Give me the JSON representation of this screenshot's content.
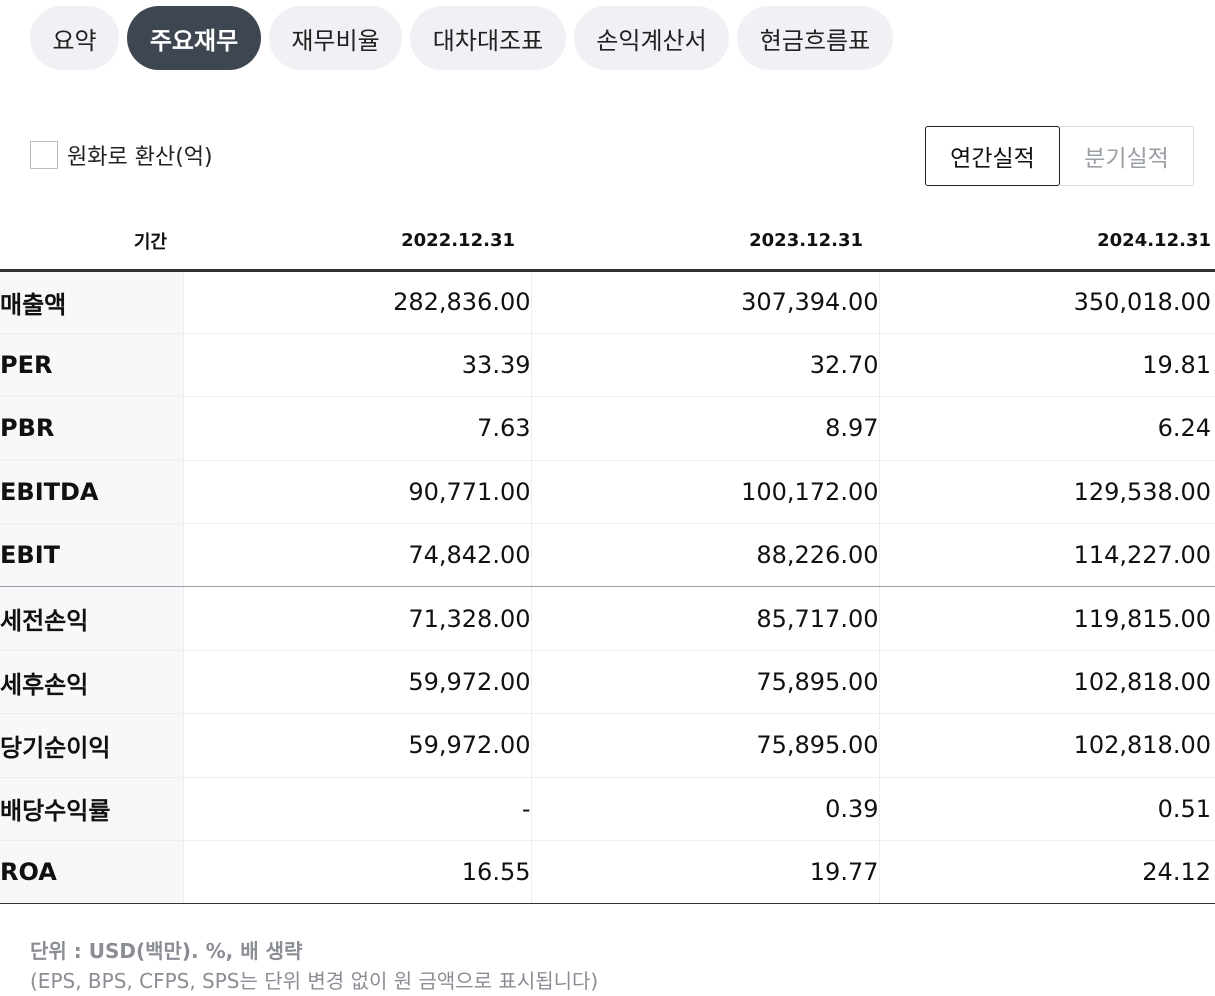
{
  "tabs": [
    {
      "label": "요약"
    },
    {
      "label": "주요재무"
    },
    {
      "label": "재무비율"
    },
    {
      "label": "대차대조표"
    },
    {
      "label": "손익계산서"
    },
    {
      "label": "현금흐름표"
    }
  ],
  "active_tab": "주요재무",
  "convert_checkbox": {
    "label": "원화로 환산(억)",
    "checked": false
  },
  "period_toggle": {
    "annual": "연간실적",
    "quarterly": "분기실적",
    "selected": "연간실적"
  },
  "table": {
    "header": {
      "label": "기간",
      "years": [
        "2022.12.31",
        "2023.12.31",
        "2024.12.31"
      ]
    },
    "rows": [
      {
        "label": "매출액",
        "values": [
          "282,836.00",
          "307,394.00",
          "350,018.00"
        ]
      },
      {
        "label": "PER",
        "values": [
          "33.39",
          "32.70",
          "19.81"
        ]
      },
      {
        "label": "PBR",
        "values": [
          "7.63",
          "8.97",
          "6.24"
        ]
      },
      {
        "label": "EBITDA",
        "values": [
          "90,771.00",
          "100,172.00",
          "129,538.00"
        ]
      },
      {
        "label": "EBIT",
        "values": [
          "74,842.00",
          "88,226.00",
          "114,227.00"
        ]
      },
      {
        "label": "세전손익",
        "values": [
          "71,328.00",
          "85,717.00",
          "119,815.00"
        ]
      },
      {
        "label": "세후손익",
        "values": [
          "59,972.00",
          "75,895.00",
          "102,818.00"
        ]
      },
      {
        "label": "당기순이익",
        "values": [
          "59,972.00",
          "75,895.00",
          "102,818.00"
        ]
      },
      {
        "label": "배당수익률",
        "values": [
          "-",
          "0.39",
          "0.51"
        ]
      },
      {
        "label": "ROA",
        "values": [
          "16.55",
          "19.77",
          "24.12"
        ]
      }
    ]
  },
  "footnote": {
    "unit": "단위 : USD(백만). %, 배 생략",
    "note": "(EPS, BPS, CFPS, SPS는 단위 변경 없이 원 금액으로 표시됩니다)"
  }
}
